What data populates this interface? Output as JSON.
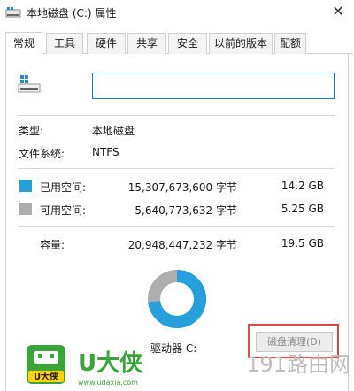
{
  "window": {
    "title": "本地磁盘 (C:) 属性",
    "close_glyph": "✕"
  },
  "tabs": [
    {
      "label": "常规",
      "active": true
    },
    {
      "label": "工具",
      "active": false
    },
    {
      "label": "硬件",
      "active": false
    },
    {
      "label": "共享",
      "active": false
    },
    {
      "label": "安全",
      "active": false
    },
    {
      "label": "以前的版本",
      "active": false
    },
    {
      "label": "配额",
      "active": false
    }
  ],
  "general": {
    "drive_name_value": "",
    "type_label": "类型:",
    "type_value": "本地磁盘",
    "fs_label": "文件系统:",
    "fs_value": "NTFS",
    "used": {
      "label": "已用空间:",
      "bytes": "15,307,673,600 字节",
      "size": "14.2 GB",
      "color": "#26a0da"
    },
    "free": {
      "label": "可用空间:",
      "bytes": "5,640,773,632 字节",
      "size": "5.25 GB",
      "color": "#adadad"
    },
    "capacity": {
      "label": "容量:",
      "bytes": "20,948,447,232 字节",
      "size": "19.5 GB"
    },
    "usage_fraction": 0.731,
    "drive_label": "驱动器 C:",
    "cleanup_button": "磁盘清理(D)"
  },
  "watermarks": {
    "left_brand": "U大侠",
    "left_badge": "U大侠",
    "left_url": "www.udaxia.com",
    "right_brand": "191路由网"
  },
  "icons": {
    "title": "drive-icon",
    "drive": "windows-drive-icon",
    "close": "close-icon"
  }
}
